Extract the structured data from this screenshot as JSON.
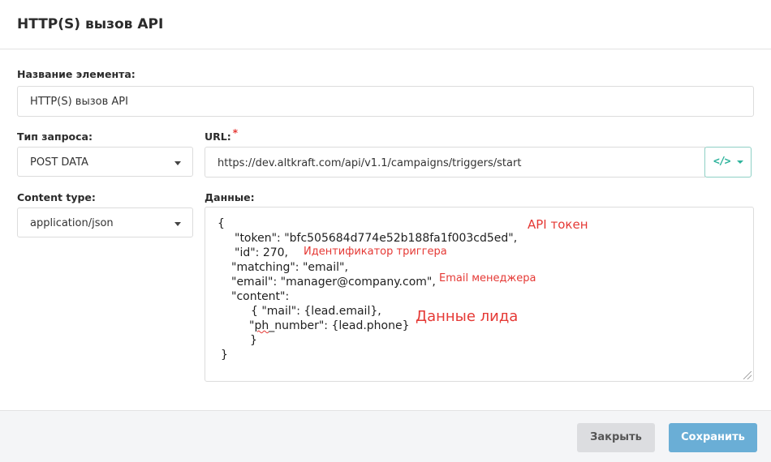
{
  "dialog": {
    "title": "HTTP(S) вызов API"
  },
  "form": {
    "name_label": "Название элемента:",
    "name_value": "HTTP(S) вызов API",
    "request_type_label": "Тип запроса:",
    "request_type_value": "POST DATA",
    "url_label": "URL:",
    "url_required": "*",
    "url_value": "https://dev.altkraft.com/api/v1.1/campaigns/triggers/start",
    "url_insert_icon": "code-icon",
    "content_type_label": "Content type:",
    "content_type_value": "application/json",
    "data_label": "Данные:",
    "data_lines": {
      "l1": "{",
      "l2": "\"token\": \"bfc505684d774e52b188fa1f003cd5ed\",",
      "l3": "\"id\": 270,",
      "l4": "\"matching\": \"email\",",
      "l5": "\"email\": \"manager@company.com\",",
      "l6": "\"content\":",
      "l7": "{ \"mail\": {lead.email},",
      "l8a": "\"",
      "l8b": "ph",
      "l8c": "_number\": {lead.phone}",
      "l9": "}",
      "l10": "}"
    },
    "annotations": {
      "token": "API токен",
      "trigger_id": "Идентификатор триггера",
      "manager_email": "Email менеджера",
      "lead_data": "Данные лида"
    }
  },
  "footer": {
    "close_label": "Закрыть",
    "save_label": "Сохранить"
  },
  "colors": {
    "accent": "#2eb39c",
    "save_button": "#6aaed6",
    "annotation": "#e53935"
  }
}
